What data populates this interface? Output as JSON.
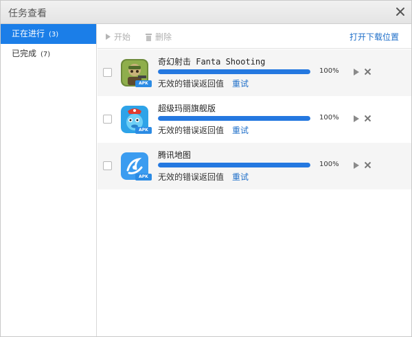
{
  "window": {
    "title": "任务查看",
    "close_icon": "close-icon"
  },
  "sidebar": {
    "items": [
      {
        "label": "正在进行",
        "count": "(3)"
      },
      {
        "label": "已完成",
        "count": "(7)"
      }
    ]
  },
  "toolbar": {
    "start_label": "开始",
    "delete_label": "删除",
    "open_folder_label": "打开下载位置"
  },
  "tasks": [
    {
      "name": "奇幻射击 Fanta Shooting",
      "progress": "100%",
      "progress_fraction": 1.0,
      "status": "无效的错误返回值",
      "retry": "重试",
      "tag": "APK"
    },
    {
      "name": "超级玛丽旗舰版",
      "progress": "100%",
      "progress_fraction": 1.0,
      "status": "无效的错误返回值",
      "retry": "重试",
      "tag": "APK"
    },
    {
      "name": "腾讯地图",
      "progress": "100%",
      "progress_fraction": 1.0,
      "status": "无效的错误返回值",
      "retry": "重试",
      "tag": "APK"
    }
  ],
  "colors": {
    "accent": "#1b7ee8",
    "link": "#1f6fc9",
    "progress": "#2478e0"
  }
}
